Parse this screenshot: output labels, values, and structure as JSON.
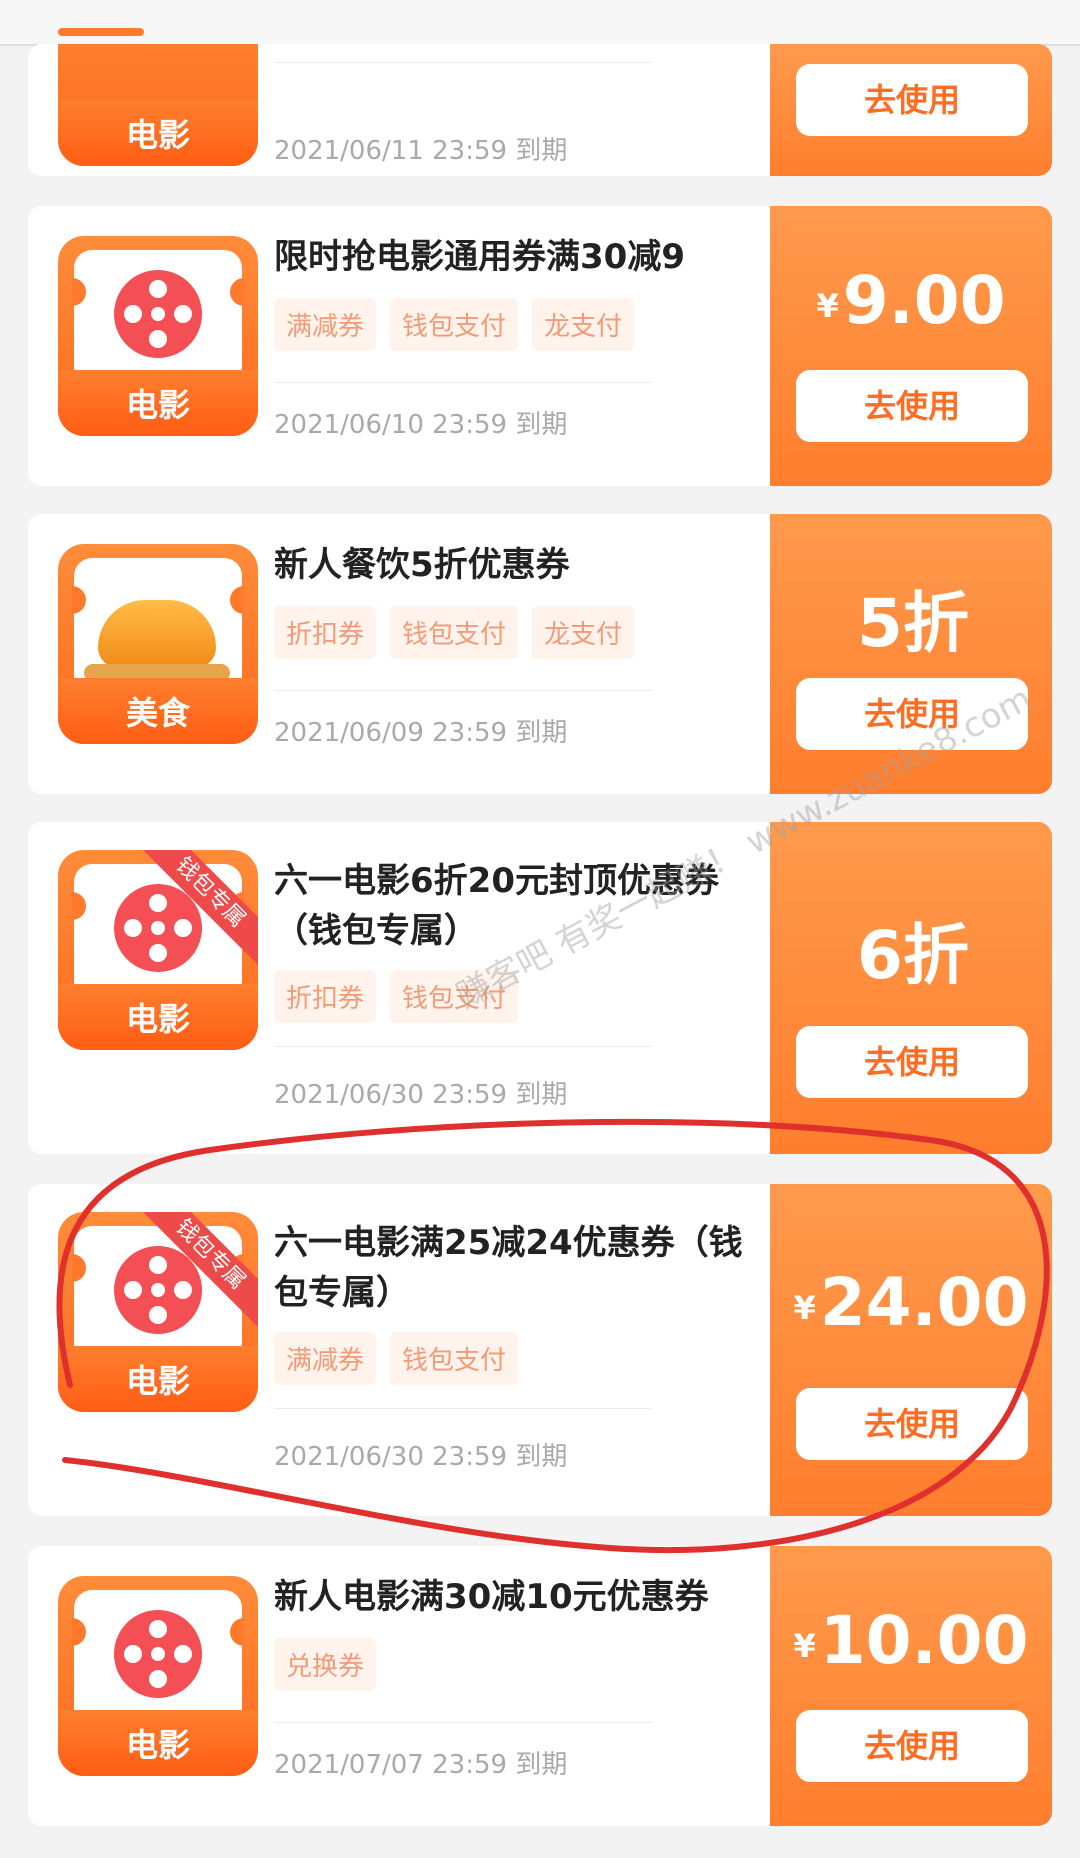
{
  "colors": {
    "accent": "#ff7a2a",
    "tag_bg": "#fff3ec",
    "tag_text": "#f39a77",
    "annotation": "#e0302e"
  },
  "action_label": "去使用",
  "expiry_suffix": "到期",
  "cards": [
    {
      "category": "电影",
      "icon": "film-reel-icon",
      "title": "",
      "tags": [],
      "date": "2021/06/11 23:59",
      "price_prefix": "",
      "price": "",
      "badge": ""
    },
    {
      "category": "电影",
      "icon": "film-reel-icon",
      "title": "限时抢电影通用券满30减9",
      "tags": [
        "满减券",
        "钱包支付",
        "龙支付"
      ],
      "date": "2021/06/10 23:59",
      "price_prefix": "¥",
      "price": "9.00",
      "badge": ""
    },
    {
      "category": "美食",
      "icon": "roast-chicken-icon",
      "title": "新人餐饮5折优惠券",
      "tags": [
        "折扣券",
        "钱包支付",
        "龙支付"
      ],
      "date": "2021/06/09 23:59",
      "price_prefix": "",
      "price": "5折",
      "badge": ""
    },
    {
      "category": "电影",
      "icon": "film-reel-icon",
      "title": "六一电影6折20元封顶优惠券（钱包专属）",
      "tags": [
        "折扣券",
        "钱包支付"
      ],
      "date": "2021/06/30 23:59",
      "price_prefix": "",
      "price": "6折",
      "badge": "钱包专属"
    },
    {
      "category": "电影",
      "icon": "film-reel-icon",
      "title": "六一电影满25减24优惠券（钱包专属）",
      "tags": [
        "满减券",
        "钱包支付"
      ],
      "date": "2021/06/30 23:59",
      "price_prefix": "¥",
      "price": "24.00",
      "badge": "钱包专属"
    },
    {
      "category": "电影",
      "icon": "film-reel-icon",
      "title": "新人电影满30减10元优惠券",
      "tags": [
        "兑换券"
      ],
      "date": "2021/07/07 23:59",
      "price_prefix": "¥",
      "price": "10.00",
      "badge": ""
    }
  ],
  "watermark": "赚客吧 有奖一起赚！ www.zuanke8.com"
}
